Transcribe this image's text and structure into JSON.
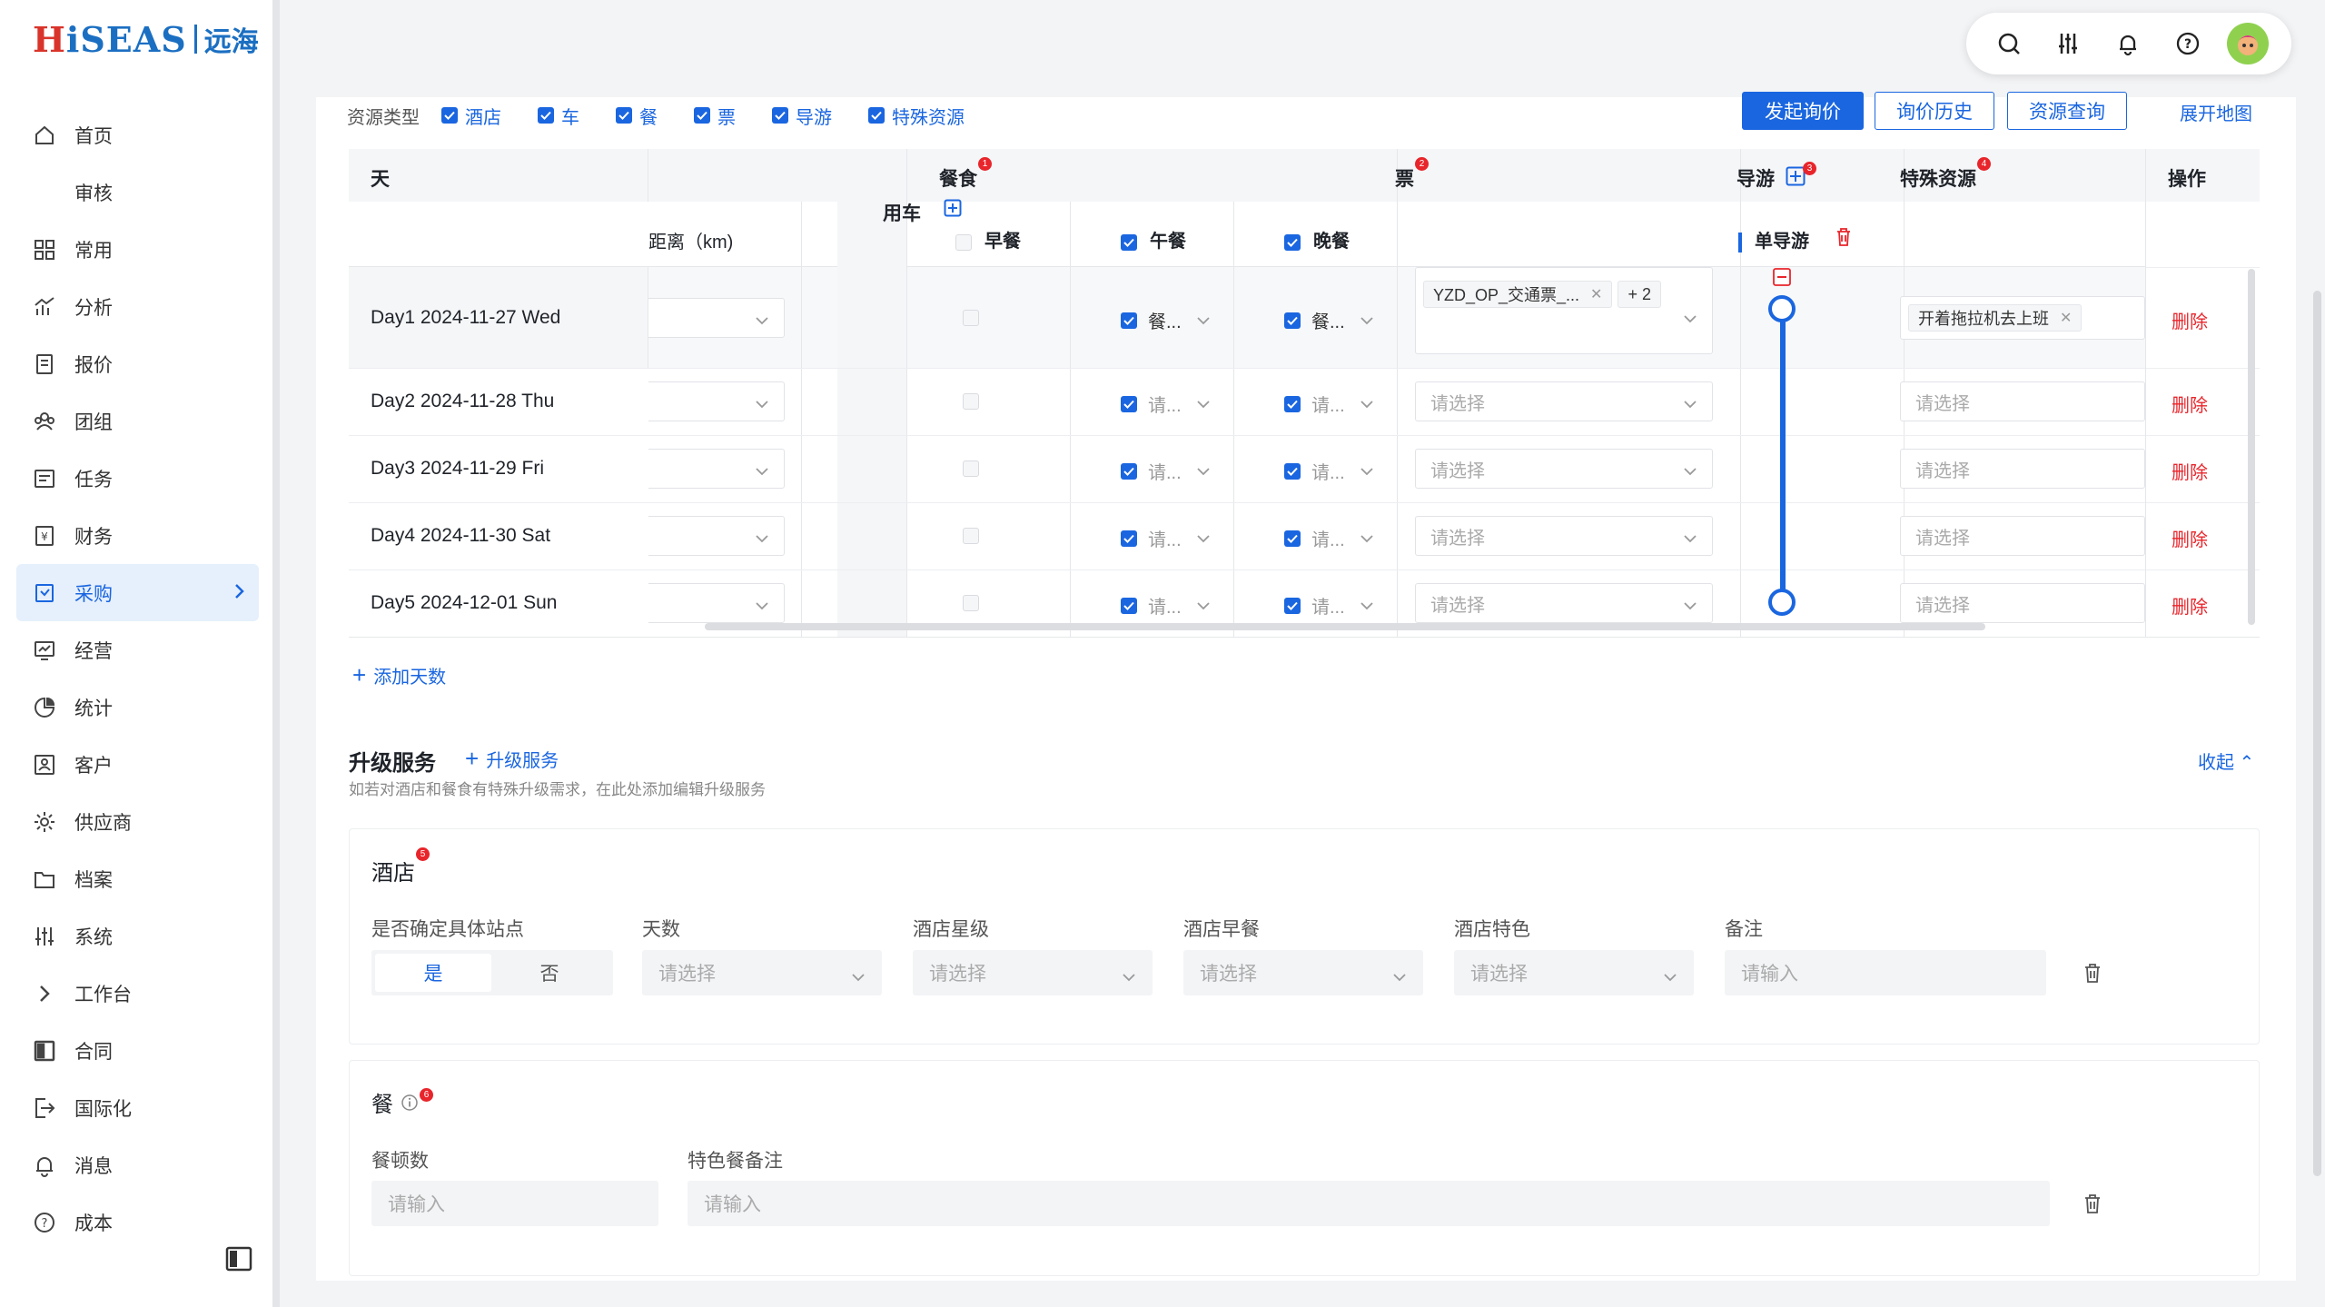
{
  "logo": {
    "brand_red": "H",
    "brand_rest": "iSEAS",
    "brand_cn": "远海"
  },
  "sidebar": {
    "items": [
      {
        "label": "首页",
        "icon": "home-icon"
      },
      {
        "label": "审核",
        "icon": ""
      },
      {
        "label": "常用",
        "icon": "grid-icon"
      },
      {
        "label": "分析",
        "icon": "analytics-icon"
      },
      {
        "label": "报价",
        "icon": "quote-icon"
      },
      {
        "label": "团组",
        "icon": "group-icon"
      },
      {
        "label": "任务",
        "icon": "task-icon"
      },
      {
        "label": "财务",
        "icon": "finance-icon"
      },
      {
        "label": "采购",
        "icon": "purchase-icon",
        "active": true
      },
      {
        "label": "经营",
        "icon": "business-icon"
      },
      {
        "label": "统计",
        "icon": "pie-icon"
      },
      {
        "label": "客户",
        "icon": "customer-icon"
      },
      {
        "label": "供应商",
        "icon": "supplier-icon"
      },
      {
        "label": "档案",
        "icon": "archive-icon"
      },
      {
        "label": "系统",
        "icon": "settings-sliders-icon"
      },
      {
        "label": "工作台",
        "icon": "chevron-right-icon"
      },
      {
        "label": "合同",
        "icon": "contract-icon"
      },
      {
        "label": "国际化",
        "icon": "export-icon"
      },
      {
        "label": "消息",
        "icon": "bell-icon"
      },
      {
        "label": "成本",
        "icon": "help-icon"
      }
    ]
  },
  "resource_types": {
    "label": "资源类型",
    "options": [
      "酒店",
      "车",
      "餐",
      "票",
      "导游",
      "特殊资源"
    ]
  },
  "actions": {
    "inquiry": "发起询价",
    "history": "询价历史",
    "resource_query": "资源查询",
    "map": "展开地图"
  },
  "table": {
    "headers": {
      "day": "天",
      "car": "用车",
      "meal": "餐食",
      "meal_badge": "1",
      "ticket": "票",
      "ticket_badge": "2",
      "guide": "导游",
      "guide_badge": "3",
      "special": "特殊资源",
      "special_badge": "4",
      "ops": "操作"
    },
    "subheaders": {
      "distance": "距离（km)",
      "breakfast": "早餐",
      "lunch": "午餐",
      "dinner": "晚餐",
      "single_guide": "单导游"
    },
    "rows": [
      {
        "day": "Day1 2024-11-27 Wed",
        "lunch": "餐...",
        "dinner": "餐...",
        "ticket_tag": "YZD_OP_交通票_...",
        "ticket_more": "+ 2",
        "special_tag": "开着拖拉机去上班",
        "delete": "删除"
      },
      {
        "day": "Day2 2024-11-28 Thu",
        "lunch": "请...",
        "dinner": "请...",
        "ticket_placeholder": "请选择",
        "special_placeholder": "请选择",
        "delete": "删除"
      },
      {
        "day": "Day3 2024-11-29 Fri",
        "lunch": "请...",
        "dinner": "请...",
        "ticket_placeholder": "请选择",
        "special_placeholder": "请选择",
        "delete": "删除"
      },
      {
        "day": "Day4 2024-11-30 Sat",
        "lunch": "请...",
        "dinner": "请...",
        "ticket_placeholder": "请选择",
        "special_placeholder": "请选择",
        "delete": "删除"
      },
      {
        "day": "Day5 2024-12-01 Sun",
        "lunch": "请...",
        "dinner": "请...",
        "ticket_placeholder": "请选择",
        "special_placeholder": "请选择",
        "delete": "删除"
      }
    ],
    "add_days": "添加天数"
  },
  "upgrade": {
    "title": "升级服务",
    "add": "升级服务",
    "hint": "如若对酒店和餐食有特殊升级需求，在此处添加编辑升级服务",
    "collapse": "收起"
  },
  "hotel": {
    "title": "酒店",
    "badge": "5",
    "labels": [
      "是否确定具体站点",
      "天数",
      "酒店星级",
      "酒店早餐",
      "酒店特色",
      "备注"
    ],
    "yes": "是",
    "no": "否",
    "select_placeholder": "请选择",
    "input_placeholder": "请输入"
  },
  "meal": {
    "title": "餐",
    "badge": "6",
    "labels": [
      "餐顿数",
      "特色餐备注"
    ],
    "input_placeholder": "请输入"
  },
  "colors": {
    "primary": "#1a66e0",
    "danger": "#e8252b"
  }
}
